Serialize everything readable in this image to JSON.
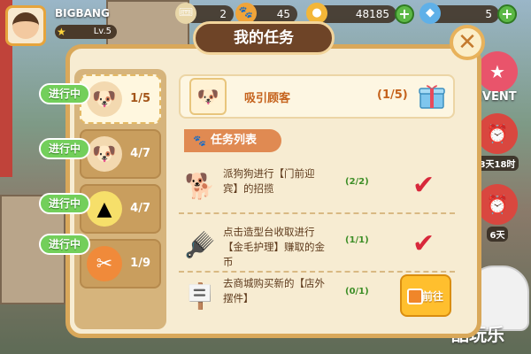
{
  "player": {
    "name": "BIGBANG",
    "level": "Lv.5"
  },
  "resources": [
    {
      "icon": "ticket-icon",
      "value": "2",
      "plus": false
    },
    {
      "icon": "paw-icon",
      "value": "45",
      "plus": false
    },
    {
      "icon": "coin-icon",
      "value": "48185",
      "plus": true
    },
    {
      "icon": "gem-icon",
      "value": "5",
      "plus": true
    }
  ],
  "modal": {
    "title": "我的任务",
    "close": "✕"
  },
  "task_list": [
    {
      "badge": "进行中",
      "count": "1/5",
      "icon": "customer-icon",
      "active": true
    },
    {
      "badge": "进行中",
      "count": "4/7",
      "icon": "customer-icon",
      "active": false
    },
    {
      "badge": "进行中",
      "count": "4/7",
      "icon": "stand-icon",
      "active": false
    },
    {
      "badge": "进行中",
      "count": "1/9",
      "icon": "scissors-medal-icon",
      "active": false
    }
  ],
  "current_task": {
    "name": "吸引顾客",
    "progress": "(1/5)"
  },
  "section_title": "任务列表",
  "subtasks": [
    {
      "text": "派狗狗进行【门前迎宾】的招揽",
      "progress": "(2/2)",
      "status": "done",
      "icon": "dog-welcome-icon"
    },
    {
      "text": "点击造型台收取进行【金毛护理】赚取的金币",
      "progress": "(1/1)",
      "status": "done",
      "icon": "grooming-table-icon"
    },
    {
      "text": "去商城购买新的【店外摆件】",
      "progress": "(0/1)",
      "status": "todo",
      "icon": "signboard-icon",
      "button": "前往"
    }
  ],
  "hud": {
    "event": "EVENT",
    "timer1": "3天18时",
    "timer2": "6天"
  },
  "watermark": "酷玩乐",
  "colors": {
    "accent": "#6e4427",
    "frame": "#d9a85a",
    "progress_green": "#73cf5b",
    "check_red": "#d8283b"
  }
}
